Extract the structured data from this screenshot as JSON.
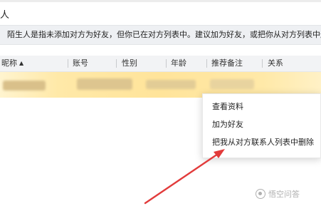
{
  "window": {
    "title": "人"
  },
  "notice": {
    "text": "陌生人是指未添加对方为好友，但你已在对方列表中。建议加为好友，或把你从对方列表中删"
  },
  "table": {
    "columns": [
      {
        "label": "昵称",
        "sorted": "ascending"
      },
      {
        "label": "账号"
      },
      {
        "label": "性别"
      },
      {
        "label": "年龄"
      },
      {
        "label": "推荐备注"
      },
      {
        "label": "关系"
      }
    ],
    "selected_row_colors": {
      "highlight": "#ffe49a"
    }
  },
  "context_menu": {
    "items": [
      {
        "label": "查看资料"
      },
      {
        "label": "加为好友"
      },
      {
        "label": "把我从对方联系人列表中删除"
      }
    ]
  },
  "annotation": {
    "arrow_color": "#e23b3b"
  },
  "watermark": {
    "text": "悟空问答"
  },
  "icons": {
    "sort": "sort-asc-icon"
  }
}
